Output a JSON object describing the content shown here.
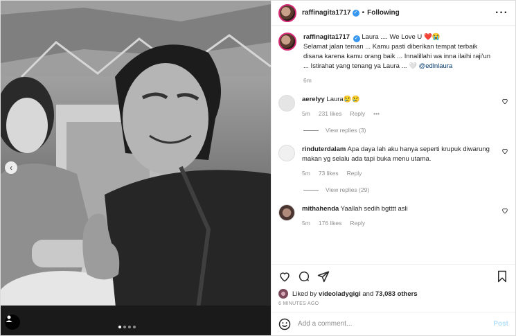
{
  "post": {
    "username": "raffinagita1717",
    "separator": "•",
    "follow_status": "Following",
    "caption_line1": "Laura .... We Love U",
    "caption_emoji": "❤️😭",
    "caption_body": "Selamat jalan teman ... Kamu pasti diberikan tempat terbaik disana karena kamu orang baik ... Innalillahi wa inna ilaihi raji'un ... Istirahat yang tenang ya Laura ... 🤍",
    "caption_mention": "@edlnlaura",
    "caption_time": "6m"
  },
  "comments": [
    {
      "username": "aerelyy",
      "text": "Laura😢😢",
      "time": "5m",
      "likes": "231 likes",
      "reply": "Reply",
      "more": "•••",
      "view_replies": "View replies (3)"
    },
    {
      "username": "rinduterdalam",
      "text": "Apa daya lah aku hanya seperti krupuk diwarung makan yg selalu ada tapi buka menu utama.",
      "time": "5m",
      "likes": "73 likes",
      "reply": "Reply",
      "view_replies": "View replies (29)"
    },
    {
      "username": "mithahenda",
      "text": "Yaallah sedih bgtttt asli",
      "time": "5m",
      "likes": "176 likes",
      "reply": "Reply"
    }
  ],
  "likes": {
    "prefix": "Liked by",
    "user": "videoladygigi",
    "and": "and",
    "count": "73,083 others"
  },
  "timestamp": "6 MINUTES AGO",
  "add_comment": {
    "placeholder": "Add a comment...",
    "post_label": "Post"
  },
  "icons": {
    "like": "heart-icon",
    "comment": "comment-icon",
    "share": "share-icon",
    "save": "bookmark-icon",
    "emoji": "smiley-icon",
    "nav_prev": "chevron-left-icon",
    "tag": "user-tag-icon"
  },
  "colors": {
    "verified": "#3897f0",
    "post_button": "#b2dffc",
    "muted_text": "#8e8e8e",
    "story_ring": "#d62976"
  }
}
